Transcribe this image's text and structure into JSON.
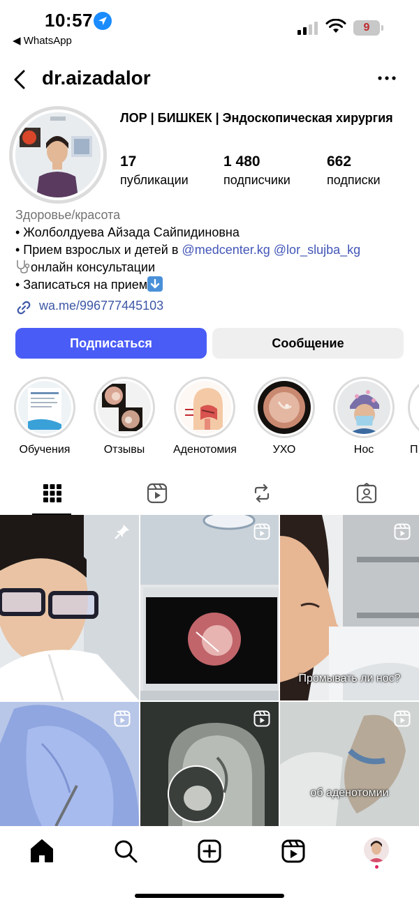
{
  "status_bar": {
    "time": "10:57",
    "back_app": "◀ WhatsApp",
    "battery": "9"
  },
  "header": {
    "username": "dr.aizadalor"
  },
  "profile": {
    "name": "ЛОР | БИШКЕК | Эндоскопическая хирургия",
    "stats": [
      {
        "value": "17",
        "label": "публикации"
      },
      {
        "value": "1 480",
        "label": "подписчики"
      },
      {
        "value": "662",
        "label": "подписки"
      }
    ],
    "category": "Здоровье/красота",
    "bio_line1": "• Жолболдуева Айзада Сайпидиновна",
    "bio_line2_prefix": "• Прием взрослых и детей в ",
    "bio_tag1": "@medcenter.kg",
    "bio_tag2": "@lor_slujba_kg",
    "bio_line3": "онлайн консультации",
    "bio_line4": "• Записаться на прием",
    "link": "wa.me/996777445103",
    "follow_label": "Подписаться",
    "message_label": "Сообщение"
  },
  "highlights": [
    {
      "label": "Обучения"
    },
    {
      "label": "Отзывы"
    },
    {
      "label": "Аденотомия"
    },
    {
      "label": "УХО"
    },
    {
      "label": "Нос"
    },
    {
      "label": "П"
    }
  ],
  "posts": {
    "captions": {
      "nose_wash": "Промывать ли нос?",
      "adenotomy": "об аденотомии"
    }
  },
  "colors": {
    "accent": "#4a5cf6",
    "link": "#4255b7",
    "category": "#737373"
  }
}
